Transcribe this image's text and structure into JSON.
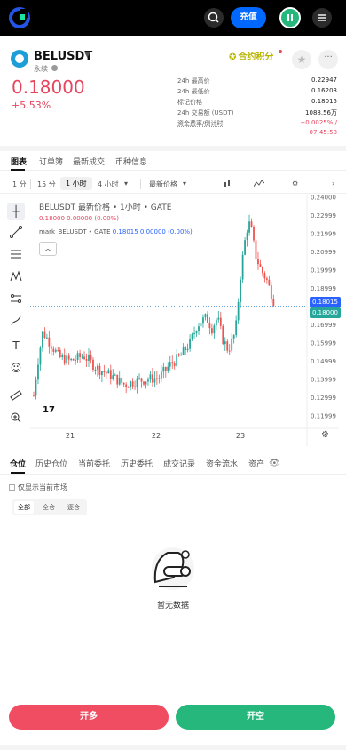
{
  "header": {
    "recharge_label": "充值"
  },
  "ticker": {
    "symbol": "BELUSDT",
    "contract_type": "永续",
    "last_price": "0.18000",
    "change_pct": "+5.53%",
    "points_label": "合约积分",
    "stats": [
      {
        "label": "24h 最高价",
        "value": "0.22947"
      },
      {
        "label": "24h 最低价",
        "value": "0.16203"
      },
      {
        "label": "标记价格",
        "value": "0.18015"
      },
      {
        "label": "24h 交易额 (USDT)",
        "value": "1088.56万"
      },
      {
        "label": "资金费率/倒计时",
        "value": "+0.0025% /"
      }
    ],
    "countdown": "07:45:58"
  },
  "chart_tabs": [
    "图表",
    "订单簿",
    "最新成交",
    "币种信息"
  ],
  "intervals": [
    "1 分",
    "15 分",
    "1 小时",
    "4 小时",
    "最新价格"
  ],
  "chart_header": {
    "title": "BELUSDT 最新价格 • 1小时 • GATE",
    "ohlc": "0.18000 0.00000 (0.00%)",
    "mark_label": "mark_BELUSDT • GATE",
    "mark_values": "0.18015 0.00000 (0.00%)"
  },
  "chart_data": {
    "type": "candlestick",
    "ylim": [
      0.115,
      0.24
    ],
    "y_ticks": [
      "0.24000",
      "0.22999",
      "0.21999",
      "0.20999",
      "0.19999",
      "0.18999",
      "0.16999",
      "0.15999",
      "0.14999",
      "0.13999",
      "0.12999",
      "0.11999"
    ],
    "x_ticks": [
      "21",
      "22",
      "23"
    ],
    "mark_price": "0.18015",
    "last_price": "0.18000"
  },
  "position_tabs": [
    "仓位",
    "历史仓位",
    "当前委托",
    "历史委托",
    "成交记录",
    "资金流水",
    "资产"
  ],
  "only_current_label": "仅显示当前市场",
  "filters": [
    "全部",
    "全仓",
    "逐仓"
  ],
  "empty_text": "暂无数据",
  "actions": {
    "long_label": "开多",
    "short_label": "开空"
  }
}
